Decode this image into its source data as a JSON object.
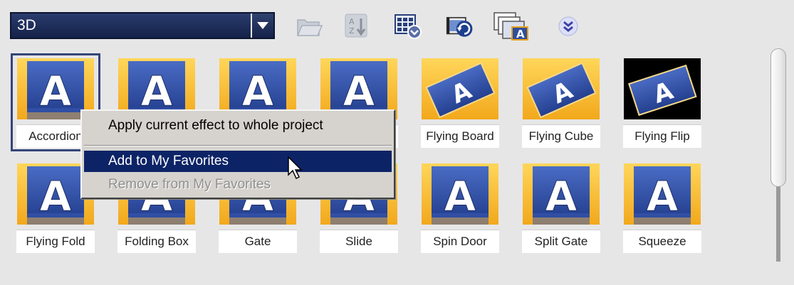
{
  "toolbar": {
    "category": "3D",
    "icons": [
      "open-folder-icon",
      "sort-icon",
      "view-options-icon",
      "apply-transition-icon",
      "favorites-icon",
      "more-options-icon"
    ]
  },
  "transitions": [
    {
      "label": "Accordion"
    },
    {
      "label": ""
    },
    {
      "label": ""
    },
    {
      "label": ""
    },
    {
      "label": "Flying Board"
    },
    {
      "label": "Flying Cube"
    },
    {
      "label": "Flying Flip"
    },
    {
      "label": "Flying Fold"
    },
    {
      "label": "Folding Box"
    },
    {
      "label": "Gate"
    },
    {
      "label": "Slide"
    },
    {
      "label": "Spin Door"
    },
    {
      "label": "Split Gate"
    },
    {
      "label": "Squeeze"
    }
  ],
  "context_menu": {
    "apply_all": "Apply current effect to whole project",
    "add_favorites": "Add to My Favorites",
    "remove_favorites": "Remove from My Favorites"
  },
  "colors": {
    "accent": "#1d2c57",
    "highlight": "#0c2366",
    "thumb_blue": "#2f4fa8",
    "thumb_orange": "#f2a81c"
  }
}
